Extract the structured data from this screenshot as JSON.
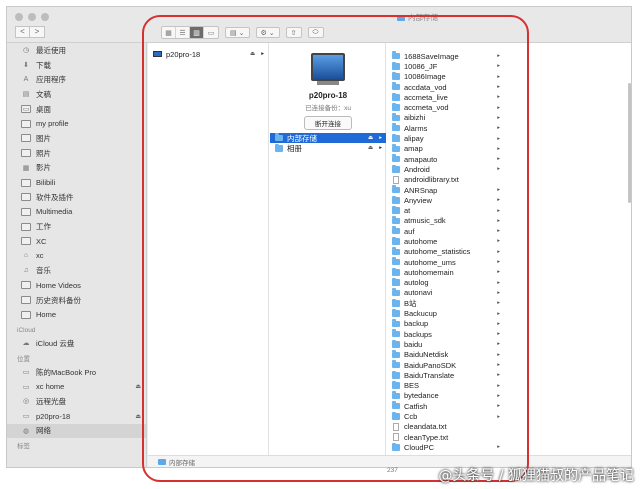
{
  "window": {
    "title": "内部存储",
    "nav_back": "<",
    "nav_forward": ">"
  },
  "sidebar": {
    "favorites": [
      {
        "label": "最近使用",
        "icon": "clock-icon"
      },
      {
        "label": "下载",
        "icon": "download-icon"
      },
      {
        "label": "应用程序",
        "icon": "applications-icon"
      },
      {
        "label": "文稿",
        "icon": "document-icon"
      },
      {
        "label": "桌面",
        "icon": "desktop-icon"
      },
      {
        "label": "my profile",
        "icon": "folder-icon"
      },
      {
        "label": "图片",
        "icon": "folder-icon"
      },
      {
        "label": "照片",
        "icon": "folder-icon"
      },
      {
        "label": "影片",
        "icon": "movie-icon"
      },
      {
        "label": "Bilibili",
        "icon": "folder-icon"
      },
      {
        "label": "软件及插件",
        "icon": "folder-icon"
      },
      {
        "label": "Multimedia",
        "icon": "folder-icon"
      },
      {
        "label": "工作",
        "icon": "folder-icon"
      },
      {
        "label": "XC",
        "icon": "folder-icon"
      },
      {
        "label": "xc",
        "icon": "home-icon"
      },
      {
        "label": "音乐",
        "icon": "music-icon"
      },
      {
        "label": "Home Videos",
        "icon": "folder-icon"
      },
      {
        "label": "历史资料备份",
        "icon": "folder-icon"
      },
      {
        "label": "Home",
        "icon": "folder-icon"
      }
    ],
    "icloud_header": "iCloud",
    "icloud": [
      {
        "label": "iCloud 云盘",
        "icon": "cloud-icon"
      }
    ],
    "locations_header": "位置",
    "locations": [
      {
        "label": "陈的MacBook Pro",
        "icon": "laptop-icon",
        "eject": ""
      },
      {
        "label": "xc home",
        "icon": "drive-icon",
        "eject": "⏏"
      },
      {
        "label": "远程光盘",
        "icon": "disc-icon",
        "eject": ""
      },
      {
        "label": "p20pro-18",
        "icon": "monitor-icon",
        "eject": "⏏"
      },
      {
        "label": "网络",
        "icon": "network-icon",
        "eject": ""
      }
    ],
    "tags_header": "标签"
  },
  "column1": {
    "items": [
      {
        "label": "p20pro-18",
        "eject": "⏏",
        "arrow": "▸"
      }
    ]
  },
  "device": {
    "name": "p20pro-18",
    "status": "已连接备份：xu",
    "disconnect_label": "断开连接"
  },
  "column2": {
    "items": [
      {
        "label": "内部存储",
        "eject": "⏏",
        "arrow": "▸",
        "selected": true
      },
      {
        "label": "相册",
        "eject": "⏏",
        "arrow": "▸",
        "selected": false
      }
    ]
  },
  "column3": {
    "items": [
      {
        "label": "1688SaveImage",
        "type": "folder"
      },
      {
        "label": "10086_JF",
        "type": "folder"
      },
      {
        "label": "10086Image",
        "type": "folder"
      },
      {
        "label": "accdata_vod",
        "type": "folder"
      },
      {
        "label": "accmeta_live",
        "type": "folder"
      },
      {
        "label": "accmeta_vod",
        "type": "folder"
      },
      {
        "label": "aibizhi",
        "type": "folder"
      },
      {
        "label": "Alarms",
        "type": "folder"
      },
      {
        "label": "alipay",
        "type": "folder"
      },
      {
        "label": "amap",
        "type": "folder"
      },
      {
        "label": "amapauto",
        "type": "folder"
      },
      {
        "label": "Android",
        "type": "folder"
      },
      {
        "label": "androidlibrary.txt",
        "type": "file"
      },
      {
        "label": "ANRSnap",
        "type": "folder"
      },
      {
        "label": "Anyview",
        "type": "folder"
      },
      {
        "label": "at",
        "type": "folder"
      },
      {
        "label": "atmusic_sdk",
        "type": "folder"
      },
      {
        "label": "auf",
        "type": "folder"
      },
      {
        "label": "autohome",
        "type": "folder"
      },
      {
        "label": "autohome_statistics",
        "type": "folder"
      },
      {
        "label": "autohome_ums",
        "type": "folder"
      },
      {
        "label": "autohomemain",
        "type": "folder"
      },
      {
        "label": "autolog",
        "type": "folder"
      },
      {
        "label": "autonavi",
        "type": "folder"
      },
      {
        "label": "B站",
        "type": "folder"
      },
      {
        "label": "Backucup",
        "type": "folder"
      },
      {
        "label": "backup",
        "type": "folder"
      },
      {
        "label": "backups",
        "type": "folder"
      },
      {
        "label": "baidu",
        "type": "folder"
      },
      {
        "label": "BaiduNetdisk",
        "type": "folder"
      },
      {
        "label": "BaiduPanoSDK",
        "type": "folder"
      },
      {
        "label": "BaiduTranslate",
        "type": "folder"
      },
      {
        "label": "BES",
        "type": "folder"
      },
      {
        "label": "bytedance",
        "type": "folder"
      },
      {
        "label": "Catfish",
        "type": "folder"
      },
      {
        "label": "Ccb",
        "type": "folder"
      },
      {
        "label": "cleandata.txt",
        "type": "file"
      },
      {
        "label": "cleanType.txt",
        "type": "file"
      },
      {
        "label": "CloudPC",
        "type": "folder"
      }
    ],
    "arrow": "▸"
  },
  "pathbar": {
    "label": "内部存储"
  },
  "status": {
    "count": "237"
  },
  "watermark": "@头条号 / 狐狸猫叔的产品笔记",
  "colors": {
    "selection": "#1f6ad6",
    "folder": "#6cb4ee",
    "annotation": "#d63030"
  }
}
